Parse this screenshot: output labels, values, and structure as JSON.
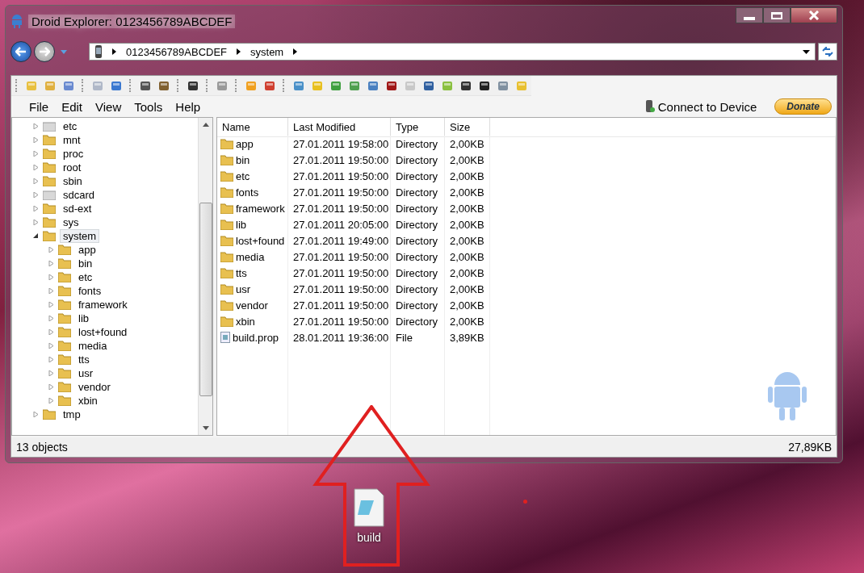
{
  "window": {
    "title": "Droid Explorer: 0123456789ABCDEF"
  },
  "address_bar": {
    "segments": [
      "0123456789ABCDEF",
      "system"
    ]
  },
  "menu": [
    "File",
    "Edit",
    "View",
    "Tools",
    "Help"
  ],
  "connect_link": "Connect to Device",
  "donate_button": "Donate",
  "tree": [
    {
      "label": "etc",
      "kind": "link",
      "expanded": false,
      "selected": false
    },
    {
      "label": "mnt",
      "kind": "folder",
      "expanded": false,
      "selected": false
    },
    {
      "label": "proc",
      "kind": "folder",
      "expanded": false,
      "selected": false
    },
    {
      "label": "root",
      "kind": "folder",
      "expanded": false,
      "selected": false
    },
    {
      "label": "sbin",
      "kind": "folder",
      "expanded": false,
      "selected": false
    },
    {
      "label": "sdcard",
      "kind": "link",
      "expanded": false,
      "selected": false
    },
    {
      "label": "sd-ext",
      "kind": "folder",
      "expanded": false,
      "selected": false
    },
    {
      "label": "sys",
      "kind": "folder",
      "expanded": false,
      "selected": false
    },
    {
      "label": "system",
      "kind": "folder",
      "expanded": true,
      "selected": true,
      "children": [
        {
          "label": "app",
          "kind": "folder",
          "expanded": false,
          "selected": false
        },
        {
          "label": "bin",
          "kind": "folder",
          "expanded": false,
          "selected": false
        },
        {
          "label": "etc",
          "kind": "folder",
          "expanded": false,
          "selected": false
        },
        {
          "label": "fonts",
          "kind": "folder",
          "expanded": false,
          "selected": false
        },
        {
          "label": "framework",
          "kind": "folder",
          "expanded": false,
          "selected": false
        },
        {
          "label": "lib",
          "kind": "folder",
          "expanded": false,
          "selected": false
        },
        {
          "label": "lost+found",
          "kind": "folder",
          "expanded": false,
          "selected": false
        },
        {
          "label": "media",
          "kind": "folder",
          "expanded": false,
          "selected": false
        },
        {
          "label": "tts",
          "kind": "folder",
          "expanded": false,
          "selected": false
        },
        {
          "label": "usr",
          "kind": "folder",
          "expanded": false,
          "selected": false
        },
        {
          "label": "vendor",
          "kind": "folder",
          "expanded": false,
          "selected": false
        },
        {
          "label": "xbin",
          "kind": "folder",
          "expanded": false,
          "selected": false
        }
      ]
    },
    {
      "label": "tmp",
      "kind": "folder",
      "expanded": false,
      "selected": false
    }
  ],
  "table": {
    "columns": [
      "Name",
      "Last Modified",
      "Type",
      "Size"
    ],
    "rows": [
      {
        "kind": "directory",
        "name": "app",
        "modified": "27.01.2011 19:58:00",
        "type": "Directory",
        "size": "2,00KB"
      },
      {
        "kind": "directory",
        "name": "bin",
        "modified": "27.01.2011 19:50:00",
        "type": "Directory",
        "size": "2,00KB"
      },
      {
        "kind": "directory",
        "name": "etc",
        "modified": "27.01.2011 19:50:00",
        "type": "Directory",
        "size": "2,00KB"
      },
      {
        "kind": "directory",
        "name": "fonts",
        "modified": "27.01.2011 19:50:00",
        "type": "Directory",
        "size": "2,00KB"
      },
      {
        "kind": "directory",
        "name": "framework",
        "modified": "27.01.2011 19:50:00",
        "type": "Directory",
        "size": "2,00KB"
      },
      {
        "kind": "directory",
        "name": "lib",
        "modified": "27.01.2011 20:05:00",
        "type": "Directory",
        "size": "2,00KB"
      },
      {
        "kind": "directory",
        "name": "lost+found",
        "modified": "27.01.2011 19:49:00",
        "type": "Directory",
        "size": "2,00KB"
      },
      {
        "kind": "directory",
        "name": "media",
        "modified": "27.01.2011 19:50:00",
        "type": "Directory",
        "size": "2,00KB"
      },
      {
        "kind": "directory",
        "name": "tts",
        "modified": "27.01.2011 19:50:00",
        "type": "Directory",
        "size": "2,00KB"
      },
      {
        "kind": "directory",
        "name": "usr",
        "modified": "27.01.2011 19:50:00",
        "type": "Directory",
        "size": "2,00KB"
      },
      {
        "kind": "directory",
        "name": "vendor",
        "modified": "27.01.2011 19:50:00",
        "type": "Directory",
        "size": "2,00KB"
      },
      {
        "kind": "directory",
        "name": "xbin",
        "modified": "27.01.2011 19:50:00",
        "type": "Directory",
        "size": "2,00KB"
      },
      {
        "kind": "file",
        "name": "build.prop",
        "modified": "28.01.2011 19:36:00",
        "type": "File",
        "size": "3,89KB"
      }
    ]
  },
  "status_bar": {
    "count": "13 objects",
    "total": "27,89KB"
  },
  "desktop_icon": {
    "label": "build"
  }
}
